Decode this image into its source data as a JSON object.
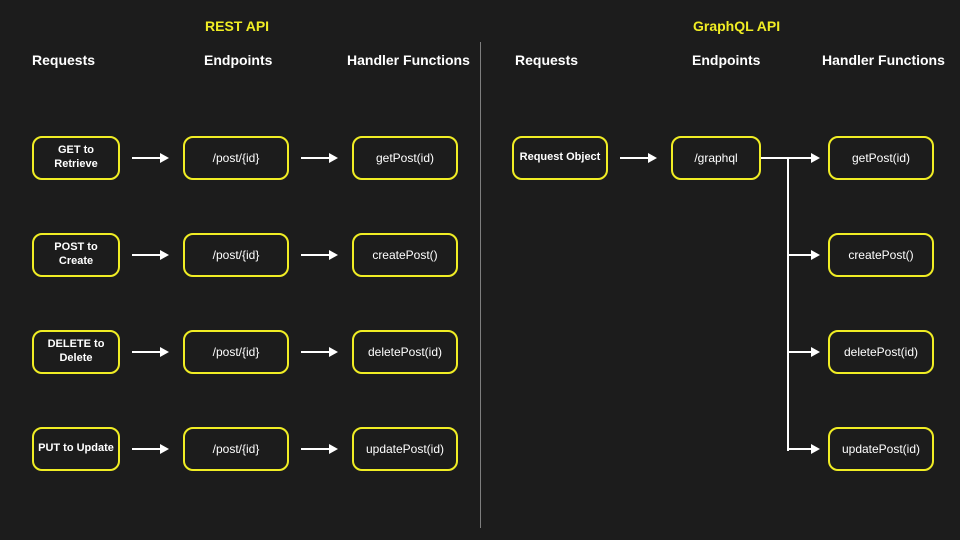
{
  "rest": {
    "title": "REST API",
    "columns": {
      "requests": "Requests",
      "endpoints": "Endpoints",
      "handlers": "Handler Functions"
    },
    "rows": [
      {
        "request": "GET to Retrieve",
        "endpoint": "/post/{id}",
        "handler": "getPost(id)"
      },
      {
        "request": "POST to Create",
        "endpoint": "/post/{id}",
        "handler": "createPost()"
      },
      {
        "request": "DELETE to Delete",
        "endpoint": "/post/{id}",
        "handler": "deletePost(id)"
      },
      {
        "request": "PUT to Update",
        "endpoint": "/post/{id}",
        "handler": "updatePost(id)"
      }
    ]
  },
  "graphql": {
    "title": "GraphQL API",
    "columns": {
      "requests": "Requests",
      "endpoints": "Endpoints",
      "handlers": "Handler Functions"
    },
    "request": "Request Object",
    "endpoint": "/graphql",
    "handlers": [
      "getPost(id)",
      "createPost()",
      "deletePost(id)",
      "updatePost(id)"
    ]
  }
}
